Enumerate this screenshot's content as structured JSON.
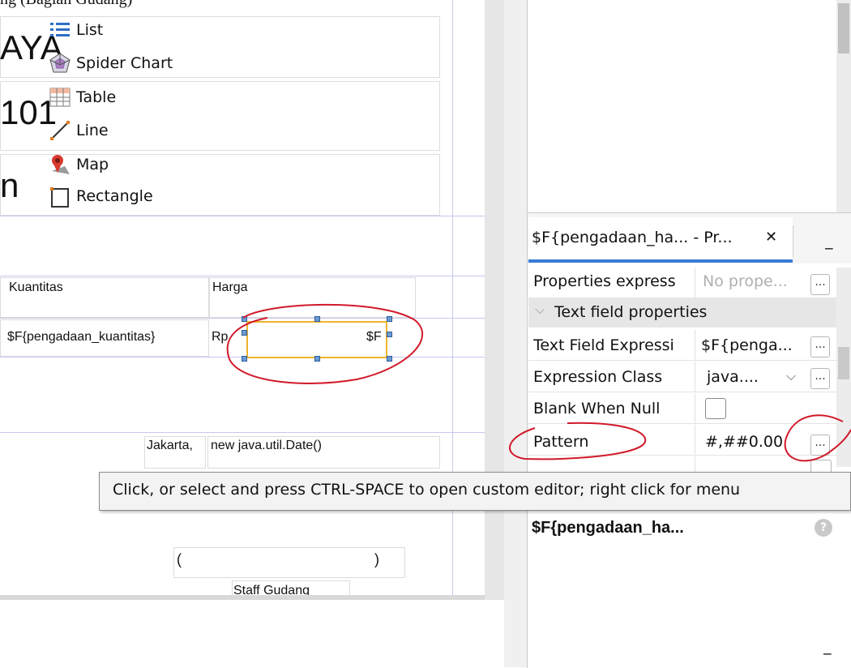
{
  "header_fragment": "ng (Bagian Gudang)",
  "report": {
    "title_1": "AYA",
    "title_2": "101",
    "title_3": "n",
    "col_kuantitas": "Kuantitas",
    "col_harga": "Harga",
    "field_kuantitas": "$F{pengadaan_kuantitas}",
    "rp_label": "Rp",
    "field_harga_short": "$F",
    "city_label": "Jakarta,",
    "date_expr": "new java.util.Date()",
    "paren_open": "(",
    "paren_close": ")",
    "staff_label": "Staff Gudang"
  },
  "palette": {
    "items": [
      {
        "label": "List",
        "icon": "list-icon"
      },
      {
        "label": "Spider Chart",
        "icon": "spider-chart-icon"
      },
      {
        "label": "Table",
        "icon": "table-icon"
      },
      {
        "label": "Line",
        "icon": "line-icon"
      },
      {
        "label": "Map",
        "icon": "map-pin-icon"
      },
      {
        "label": "Rectangle",
        "icon": "rectangle-icon"
      }
    ]
  },
  "properties": {
    "tab_title": "$F{pengadaan_ha... - Pr...",
    "close_glyph": "✕",
    "minimize_glyph": "_",
    "properties_expression_label": "Properties express",
    "properties_expression_value": "No prope...",
    "section_title": "Text field properties",
    "text_field_expression_label": "Text Field Expressi",
    "text_field_expression_value": "$F{penga...",
    "expression_class_label": "Expression Class",
    "expression_class_value": "java....",
    "blank_when_null_label": "Blank When Null",
    "blank_when_null_checked": false,
    "pattern_label": "Pattern",
    "pattern_value": "#,##0.00",
    "dots": "...",
    "element_name": "$F{pengadaan_ha...",
    "help_glyph": "?"
  },
  "tooltip": "Click, or select and press CTRL-SPACE to open custom editor; right click for menu",
  "bottom_minimize": "_",
  "colors": {
    "selection": "#f0b429",
    "annotation": "#d11a2a",
    "tab_underline": "#3a7bd5",
    "section_bg": "#e6e6e6"
  }
}
